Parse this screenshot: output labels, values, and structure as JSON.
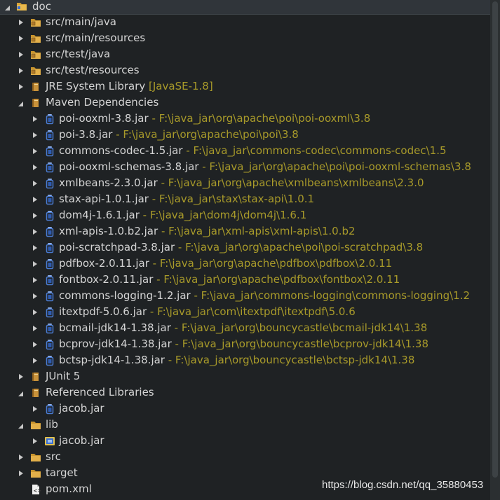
{
  "project": {
    "name": "doc"
  },
  "folders": [
    {
      "label": "src/main/java"
    },
    {
      "label": "src/main/resources"
    },
    {
      "label": "src/test/java"
    },
    {
      "label": "src/test/resources"
    }
  ],
  "jre": {
    "label": "JRE System Library",
    "decoration": "[JavaSE-1.8]"
  },
  "maven": {
    "label": "Maven Dependencies",
    "jars": [
      {
        "name": "poi-ooxml-3.8.jar",
        "path": "F:\\java_jar\\org\\apache\\poi\\poi-ooxml\\3.8"
      },
      {
        "name": "poi-3.8.jar",
        "path": "F:\\java_jar\\org\\apache\\poi\\poi\\3.8"
      },
      {
        "name": "commons-codec-1.5.jar",
        "path": "F:\\java_jar\\commons-codec\\commons-codec\\1.5"
      },
      {
        "name": "poi-ooxml-schemas-3.8.jar",
        "path": "F:\\java_jar\\org\\apache\\poi\\poi-ooxml-schemas\\3.8"
      },
      {
        "name": "xmlbeans-2.3.0.jar",
        "path": "F:\\java_jar\\org\\apache\\xmlbeans\\xmlbeans\\2.3.0"
      },
      {
        "name": "stax-api-1.0.1.jar",
        "path": "F:\\java_jar\\stax\\stax-api\\1.0.1"
      },
      {
        "name": "dom4j-1.6.1.jar",
        "path": "F:\\java_jar\\dom4j\\dom4j\\1.6.1"
      },
      {
        "name": "xml-apis-1.0.b2.jar",
        "path": "F:\\java_jar\\xml-apis\\xml-apis\\1.0.b2"
      },
      {
        "name": "poi-scratchpad-3.8.jar",
        "path": "F:\\java_jar\\org\\apache\\poi\\poi-scratchpad\\3.8"
      },
      {
        "name": "pdfbox-2.0.11.jar",
        "path": "F:\\java_jar\\org\\apache\\pdfbox\\pdfbox\\2.0.11"
      },
      {
        "name": "fontbox-2.0.11.jar",
        "path": "F:\\java_jar\\org\\apache\\pdfbox\\fontbox\\2.0.11"
      },
      {
        "name": "commons-logging-1.2.jar",
        "path": "F:\\java_jar\\commons-logging\\commons-logging\\1.2"
      },
      {
        "name": "itextpdf-5.0.6.jar",
        "path": "F:\\java_jar\\com\\itextpdf\\itextpdf\\5.0.6"
      },
      {
        "name": "bcmail-jdk14-1.38.jar",
        "path": "F:\\java_jar\\org\\bouncycastle\\bcmail-jdk14\\1.38"
      },
      {
        "name": "bcprov-jdk14-1.38.jar",
        "path": "F:\\java_jar\\org\\bouncycastle\\bcprov-jdk14\\1.38"
      },
      {
        "name": "bctsp-jdk14-1.38.jar",
        "path": "F:\\java_jar\\org\\bouncycastle\\bctsp-jdk14\\1.38"
      }
    ]
  },
  "junit": {
    "label": "JUnit 5"
  },
  "referenced": {
    "label": "Referenced Libraries",
    "jar": "jacob.jar"
  },
  "lib": {
    "label": "lib",
    "jar": "jacob.jar"
  },
  "src": {
    "label": "src"
  },
  "target": {
    "label": "target"
  },
  "pom": {
    "label": "pom.xml"
  },
  "separator": " - ",
  "watermark": "https://blog.csdn.net/qq_35880453",
  "colors": {
    "background": "#1f2224",
    "decoration": "#a89a2a",
    "text": "#d4d4d4",
    "jar_icon": "#4a7bd0",
    "folder": "#d8a43a"
  }
}
